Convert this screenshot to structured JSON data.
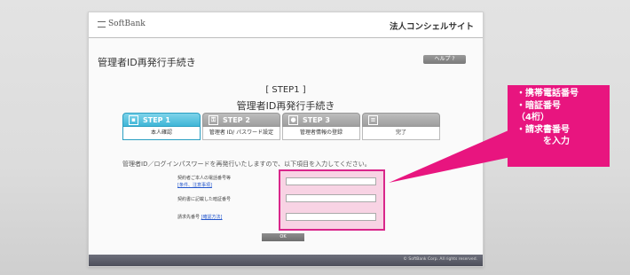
{
  "header": {
    "logo_text": "SoftBank",
    "site_title": "法人コンシェルサイト"
  },
  "page_heading": "管理者ID再発行手続き",
  "help_button": "ヘルプ ?",
  "step_title": "[ STEP1 ]",
  "step_subtitle": "管理者ID再発行手続き",
  "steps": [
    {
      "label": "STEP 1",
      "caption": "本人確認",
      "icon": "id-card-icon"
    },
    {
      "label": "STEP 2",
      "caption": "管理者 ID/ パスワード設定",
      "icon": "key-icon"
    },
    {
      "label": "STEP 3",
      "caption": "管理者情報の登録",
      "icon": "person-icon"
    },
    {
      "label": "",
      "caption": "完了",
      "icon": "document-icon"
    }
  ],
  "instruction": "管理者ID／ログインパスワードを再発行いたしますので、以下項目を入力してください。",
  "form": {
    "phone_label": "契約者ご本人の電話番号等",
    "phone_link": "[条件、注意事項]",
    "pin_label": "契約書に記載した暗証番号",
    "invoice_label": "請求先番号",
    "invoice_link": "[確認方法]"
  },
  "ok_button": "OK",
  "footer": {
    "copyright": "© SoftBank Corp. All rights reserved."
  },
  "callout": {
    "line1": "・携帯電話番号",
    "line2": "・暗証番号",
    "line3": "（4桁）",
    "line4": "・請求書番号",
    "line5": "を入力"
  },
  "colors": {
    "accent": "#e8157f",
    "step_active": "#3fb6d7",
    "footer": "#5a5c68"
  }
}
